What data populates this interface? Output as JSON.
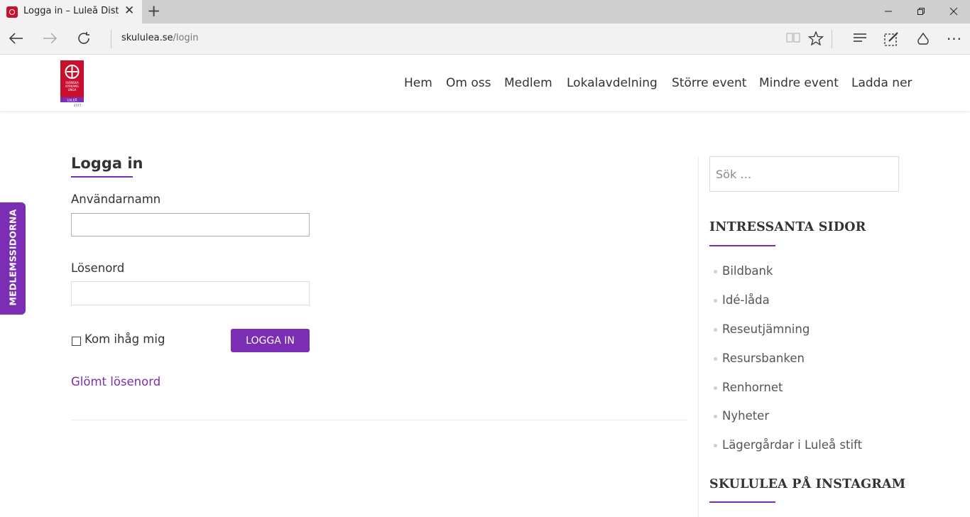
{
  "browser": {
    "tab_title": "Logga in – Luleå Distrikt",
    "url_host": "skululea.se",
    "url_path": "/login"
  },
  "site": {
    "logo_text": [
      "SVENSKA",
      "KYRKANS",
      "UNGA",
      "LULEÅ",
      "STIFT"
    ],
    "brand_color": "#7b2eb3",
    "logo_color": "#c8102e",
    "nav": [
      "Hem",
      "Om oss",
      "Medlem",
      "Lokalavdelning",
      "Större event",
      "Mindre event",
      "Ladda ner"
    ]
  },
  "side_tab": {
    "label": "MEDLEMSSIDORNA"
  },
  "login": {
    "title": "Logga in",
    "username_label": "Användarnamn",
    "username_value": "",
    "password_label": "Lösenord",
    "password_value": "",
    "remember_label": "Kom ihåg mig",
    "remember_checked": false,
    "button_label": "LOGGA IN",
    "forgot_link": "Glömt lösenord"
  },
  "sidebar": {
    "search_placeholder": "Sök …",
    "interesting_title": "INTRESSANTA SIDOR",
    "links": [
      "Bildbank",
      "Idé-låda",
      "Reseutjämning",
      "Resursbanken",
      "Renhornet",
      "Nyheter",
      "Lägergårdar i Luleå stift"
    ],
    "instagram_title": "SKULULEA PÅ INSTAGRAM"
  }
}
